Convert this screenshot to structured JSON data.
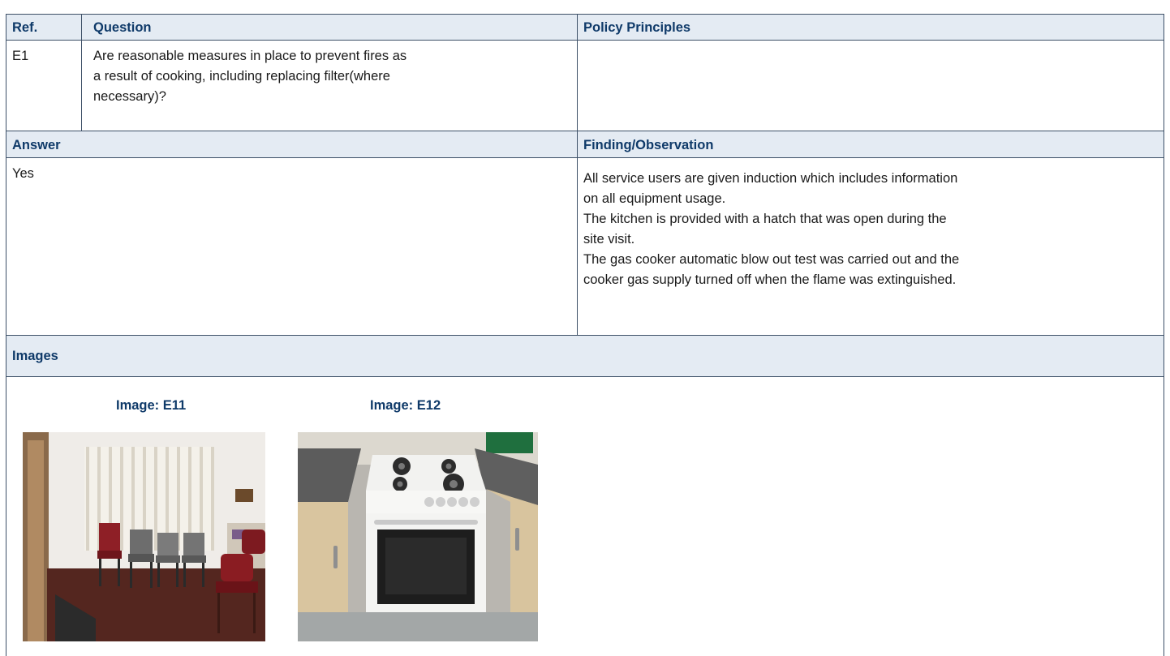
{
  "table": {
    "ref_header": "Ref.",
    "question_header": "Question",
    "policy_header": "Policy Principles",
    "ref_value": "E1",
    "question_lines": [
      "Are reasonable measures in place to prevent fires as",
      "a result of cooking, including replacing filter(where",
      "necessary)?"
    ],
    "policy_value": "",
    "answer_header": "Answer",
    "finding_header": "Finding/Observation",
    "answer_value": "Yes",
    "finding_lines": [
      "All service users are given induction which includes information",
      "on all equipment usage.",
      "The kitchen is provided with a hatch that was open during the",
      "site visit.",
      "The gas cooker automatic blow out test was carried out and the",
      "cooker gas supply turned off when the flame was extinguished."
    ],
    "images_header": "Images"
  },
  "images": [
    {
      "caption": "Image: E11",
      "subject": "room with stacked chairs and window blinds"
    },
    {
      "caption": "Image: E12",
      "subject": "white gas cooker between kitchen cabinets"
    }
  ],
  "colors": {
    "header_bg": "#e4ebf3",
    "header_text": "#0f3a69",
    "border": "#3d5067"
  }
}
